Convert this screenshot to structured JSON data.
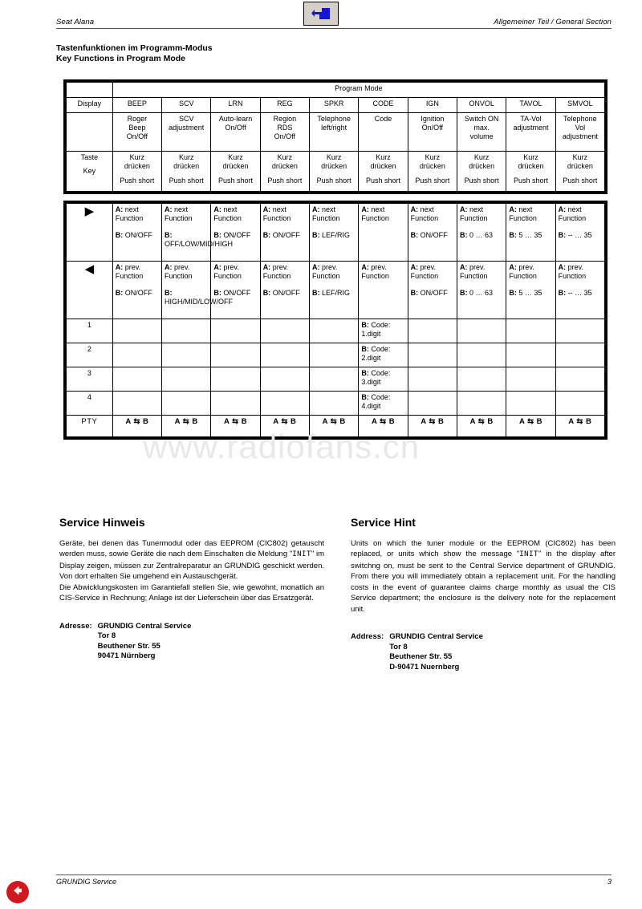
{
  "nav": {
    "back_icon": "back-arrow-icon",
    "bottom_back_icon": "circle-back-arrow-icon"
  },
  "header": {
    "left": "Seat Alana",
    "right": "Allgemeiner Teil / General Section"
  },
  "section": {
    "title_de": "Tastenfunktionen im Programm-Modus",
    "title_en": "Key Functions in Program Mode"
  },
  "watermark": "www.radiofans.cn",
  "table": {
    "program_mode_label": "Program Mode",
    "display_label": "Display",
    "key_label_de": "Taste",
    "key_label_en": "Key",
    "columns": [
      "BEEP",
      "SCV",
      "LRN",
      "REG",
      "SPKR",
      "CODE",
      "IGN",
      "ONVOL",
      "TAVOL",
      "SMVOL"
    ],
    "functions": [
      "Roger\nBeep\nOn/Off",
      "SCV\nadjustment",
      "Auto-learn\nOn/Off",
      "Region\nRDS\nOn/Off",
      "Telephone\nleft/right",
      "Code",
      "Ignition\nOn/Off",
      "Switch ON\nmax.\nvolume",
      "TA-Vol\nadjustment",
      "Telephone\nVol\nadjustment"
    ],
    "key_action_de": "Kurz\ndrücken",
    "key_action_en": "Push short",
    "rows": [
      {
        "label_icon": "arrow-right-icon",
        "label": "▶",
        "cells": [
          {
            "a": "A: next Function",
            "b": "B: ON/OFF"
          },
          {
            "a": "A: next Function",
            "b": "B: OFF/LOW/MID/HIGH"
          },
          {
            "a": "A: next Function",
            "b": "B: ON/OFF"
          },
          {
            "a": "A: next Function",
            "b": "B: ON/OFF"
          },
          {
            "a": "A: next Function",
            "b": "B: LEF/RIG"
          },
          {
            "a": "A: next Function",
            "b": ""
          },
          {
            "a": "A: next Function",
            "b": "B: ON/OFF"
          },
          {
            "a": "A: next Function",
            "b": "B: 0 … 63"
          },
          {
            "a": "A: next Function",
            "b": "B: 5 … 35"
          },
          {
            "a": "A: next Function",
            "b": "B: -- … 35"
          }
        ]
      },
      {
        "label_icon": "arrow-left-icon",
        "label": "◀",
        "cells": [
          {
            "a": "A: prev. Function",
            "b": "B: ON/OFF"
          },
          {
            "a": "A: prev. Function",
            "b": "B: HIGH/MID/LOW/OFF"
          },
          {
            "a": "A: prev. Function",
            "b": "B: ON/OFF"
          },
          {
            "a": "A: prev. Function",
            "b": "B: ON/OFF"
          },
          {
            "a": "A: prev. Function",
            "b": "B: LEF/RIG"
          },
          {
            "a": "A: prev. Function",
            "b": ""
          },
          {
            "a": "A: prev. Function",
            "b": "B: ON/OFF"
          },
          {
            "a": "A: prev. Function",
            "b": "B: 0 … 63"
          },
          {
            "a": "A: prev. Function",
            "b": "B: 5 … 35"
          },
          {
            "a": "A: prev. Function",
            "b": "B: -- … 35"
          }
        ]
      },
      {
        "label": "1",
        "code_cell": "B: Code: 1.digit"
      },
      {
        "label": "2",
        "code_cell": "B: Code: 2.digit"
      },
      {
        "label": "3",
        "code_cell": "B: Code: 3.digit"
      },
      {
        "label": "4",
        "code_cell": "B: Code: 4.digit"
      }
    ],
    "pty_label": "PTY",
    "pty_value": "A ⇆ B"
  },
  "service_de": {
    "heading": "Service Hinweis",
    "body_1": "Geräte, bei denen das Tunermodul oder das EEPROM (CIC802) getauscht werden muss, sowie Geräte die nach dem Einschalten die Meldung \"",
    "body_init": "INIT",
    "body_2": "\" im Display zeigen, müssen zur Zentralreparatur an GRUNDIG geschickt werden. Von dort erhalten Sie umgehend ein Austauschgerät.",
    "body_3": "Die Abwicklungskosten im Garantiefall stellen Sie, wie gewohnt, monatlich an CIS-Service in Rechnung; Anlage ist der Lieferschein über das Ersatzgerät.",
    "address_label": "Adresse:",
    "address_lines": [
      "GRUNDIG Central Service",
      "Tor 8",
      "Beuthener Str. 55",
      "90471 Nürnberg"
    ]
  },
  "service_en": {
    "heading": "Service Hint",
    "body_1": "Units on which the tuner module or the EEPROM (CIC802) has been replaced, or units which show the message \"",
    "body_init": "INIT",
    "body_2": "\" in the display after switchng on, must be sent to the Central Service department of GRUNDIG. From there you will immediately obtain a replacement unit. For the handling costs in the event of guarantee claims charge monthly as usual the CIS Service department; the enclosure is the delivery note for the replacement unit.",
    "address_label": "Address:",
    "address_lines": [
      "GRUNDIG Central Service",
      "Tor 8",
      "Beuthener Str. 55",
      "D-90471 Nuernberg"
    ]
  },
  "footer": {
    "left": "GRUNDIG Service",
    "page": "3"
  }
}
